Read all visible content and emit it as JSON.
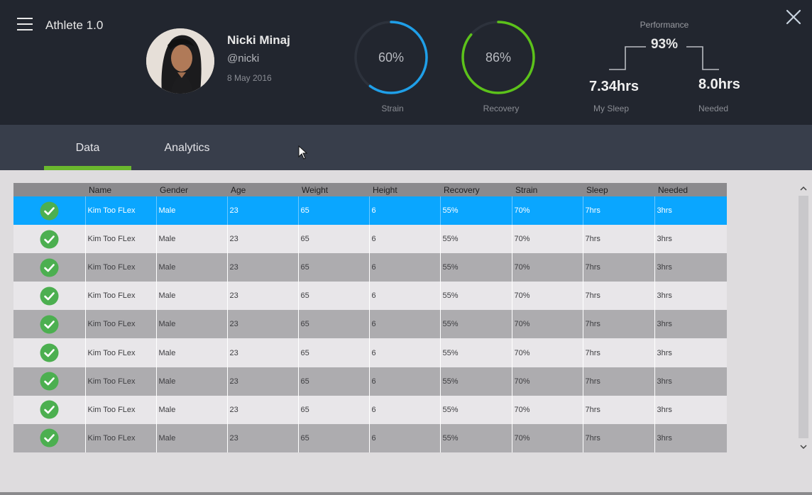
{
  "app": {
    "title": "Athlete 1.0"
  },
  "user": {
    "name": "Nicki Minaj",
    "handle": "@nicki",
    "date": "8 May 2016"
  },
  "metrics": {
    "strain": {
      "value": "60%",
      "label": "Strain",
      "fraction": 0.6,
      "color": "#1f9fe8"
    },
    "recovery": {
      "value": "86%",
      "label": "Recovery",
      "fraction": 0.86,
      "color": "#5cc21a"
    }
  },
  "performance": {
    "label": "Performance",
    "value": "93%",
    "my_sleep": {
      "value": "7.34hrs",
      "label": "My Sleep"
    },
    "needed": {
      "value": "8.0hrs",
      "label": "Needed"
    }
  },
  "tabs": [
    {
      "label": "Data",
      "active": true
    },
    {
      "label": "Analytics",
      "active": false
    }
  ],
  "table": {
    "columns": [
      "",
      "Name",
      "Gender",
      "Age",
      "Weight",
      "Height",
      "Recovery",
      "Strain",
      "Sleep",
      "Needed"
    ],
    "rows": [
      [
        "Kim Too FLex",
        "Male",
        "23",
        "65",
        "6",
        "55%",
        "70%",
        "7hrs",
        "3hrs"
      ],
      [
        "Kim Too FLex",
        "Male",
        "23",
        "65",
        "6",
        "55%",
        "70%",
        "7hrs",
        "3hrs"
      ],
      [
        "Kim Too FLex",
        "Male",
        "23",
        "65",
        "6",
        "55%",
        "70%",
        "7hrs",
        "3hrs"
      ],
      [
        "Kim Too FLex",
        "Male",
        "23",
        "65",
        "6",
        "55%",
        "70%",
        "7hrs",
        "3hrs"
      ],
      [
        "Kim Too FLex",
        "Male",
        "23",
        "65",
        "6",
        "55%",
        "70%",
        "7hrs",
        "3hrs"
      ],
      [
        "Kim Too FLex",
        "Male",
        "23",
        "65",
        "6",
        "55%",
        "70%",
        "7hrs",
        "3hrs"
      ],
      [
        "Kim Too FLex",
        "Male",
        "23",
        "65",
        "6",
        "55%",
        "70%",
        "7hrs",
        "3hrs"
      ],
      [
        "Kim Too FLex",
        "Male",
        "23",
        "65",
        "6",
        "55%",
        "70%",
        "7hrs",
        "3hrs"
      ],
      [
        "Kim Too FLex",
        "Male",
        "23",
        "65",
        "6",
        "55%",
        "70%",
        "7hrs",
        "3hrs"
      ]
    ],
    "selected_row": 0,
    "row_icon": "check-circle-icon",
    "check_color": "#4caf50",
    "selected_color": "#0aa6ff"
  },
  "icons": {
    "menu": "hamburger-menu-icon",
    "close": "close-icon",
    "scroll_up": "chevron-up-icon",
    "scroll_down": "chevron-down-icon",
    "cursor": "mouse-cursor-icon"
  },
  "colors": {
    "header_bg": "#22262f",
    "tabbar_bg": "#383e4b",
    "tab_underline": "#6bb82e",
    "content_bg": "#dedcde"
  }
}
